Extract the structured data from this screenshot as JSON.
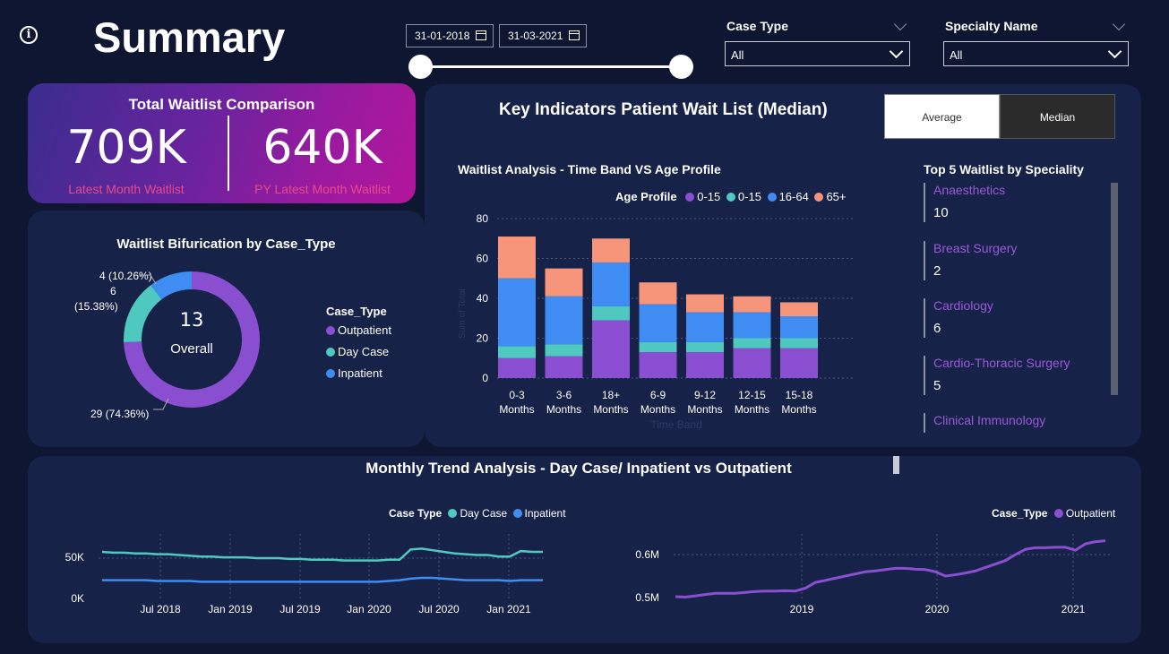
{
  "header": {
    "title": "Summary"
  },
  "date_filter": {
    "start": "31-01-2018",
    "end": "31-03-2021"
  },
  "filters": {
    "case_type": {
      "label": "Case Type",
      "value": "All"
    },
    "specialty": {
      "label": "Specialty Name",
      "value": "All"
    }
  },
  "kpi": {
    "title": "Total Waitlist Comparison",
    "latest_value": "709K",
    "latest_label": "Latest Month Waitlist",
    "py_value": "640K",
    "py_label": "PY Latest Month Waitlist"
  },
  "donut": {
    "title": "Waitlist Bifurication by Case_Type",
    "center_value": "13",
    "center_label": "Overall",
    "legend_title": "Case_Type",
    "slices": [
      {
        "name": "Outpatient",
        "value": 29,
        "label": "29 (74.36%)",
        "color": "#8a4fd1"
      },
      {
        "name": "Day Case",
        "value": 6,
        "label_1": "6",
        "label_2": "(15.38%)",
        "color": "#4fc9c0"
      },
      {
        "name": "Inpatient",
        "value": 4,
        "label": "4 (10.26%)",
        "color": "#3f8cf2"
      }
    ]
  },
  "key_indicators": {
    "title": "Key Indicators Patient Wait List (Median)",
    "toggle_average": "Average",
    "toggle_median": "Median"
  },
  "bar_chart": {
    "title": "Waitlist Analysis - Time Band VS Age Profile",
    "legend_title": "Age Profile",
    "legend": [
      "0-15",
      "0-15",
      "16-64",
      "65+"
    ],
    "colors": [
      "#8a4fd1",
      "#4fc9c0",
      "#3f8cf2",
      "#f7957a"
    ],
    "xlabel": "Time Band",
    "ylabel": "Sum of Total"
  },
  "top5": {
    "title": "Top 5 Waitlist by Speciality",
    "items": [
      {
        "name": "Anaesthetics",
        "value": "10"
      },
      {
        "name": "Breast Surgery",
        "value": "2"
      },
      {
        "name": "Cardiology",
        "value": "6"
      },
      {
        "name": "Cardio-Thoracic Surgery",
        "value": "5"
      },
      {
        "name": "Clinical Immunology",
        "value": ""
      }
    ]
  },
  "trend": {
    "title": "Monthly Trend Analysis - Day Case/ Inpatient vs Outpatient",
    "left_legend_title": "Case Type",
    "left_legend": [
      "Day Case",
      "Inpatient"
    ],
    "right_legend_title": "Case_Type",
    "right_legend": [
      "Outpatient"
    ],
    "left_y_ticks": [
      "50K",
      "0K"
    ],
    "left_x_ticks": [
      "Jul 2018",
      "Jan 2019",
      "Jul 2019",
      "Jan 2020",
      "Jul 2020",
      "Jan 2021"
    ],
    "right_y_ticks": [
      "0.6M",
      "0.5M"
    ],
    "right_x_ticks": [
      "2019",
      "2020",
      "2021"
    ]
  },
  "chart_data": [
    {
      "type": "bar",
      "title": "Waitlist Analysis - Time Band VS Age Profile",
      "categories": [
        "0-3 Months",
        "3-6 Months",
        "18+ Months",
        "6-9 Months",
        "9-12 Months",
        "12-15 Months",
        "15-18 Months"
      ],
      "category_lines": [
        [
          "0-3",
          "Months"
        ],
        [
          "3-6",
          "Months"
        ],
        [
          "18+",
          "Months"
        ],
        [
          "6-9",
          "Months"
        ],
        [
          "9-12",
          "Months"
        ],
        [
          "12-15",
          "Months"
        ],
        [
          "15-18",
          "Months"
        ]
      ],
      "series": [
        {
          "name": "0-15",
          "values": [
            10,
            11,
            29,
            13,
            13,
            15,
            15
          ]
        },
        {
          "name": "0-15",
          "values": [
            6,
            6,
            7,
            5,
            5,
            5,
            5
          ]
        },
        {
          "name": "16-64",
          "values": [
            34,
            24,
            22,
            19,
            15,
            13,
            11
          ]
        },
        {
          "name": "65+",
          "values": [
            21,
            14,
            12,
            11,
            9,
            8,
            7
          ]
        }
      ],
      "stacked": true,
      "ylim": [
        0,
        80
      ],
      "yticks": [
        0,
        20,
        40,
        60,
        80
      ],
      "xlabel": "Time Band",
      "ylabel": "Sum of Total"
    },
    {
      "type": "line",
      "series": [
        {
          "name": "Day Case",
          "values": [
            58,
            57,
            57,
            56,
            56,
            55,
            55,
            54,
            53,
            52,
            52,
            51,
            51,
            51,
            50,
            50,
            50,
            49,
            49,
            48,
            48,
            48,
            47,
            47,
            47,
            47,
            48,
            48,
            61,
            62,
            60,
            58,
            56,
            55,
            54,
            54,
            52,
            52,
            59,
            58,
            58
          ]
        },
        {
          "name": "Inpatient",
          "values": [
            22,
            22,
            22,
            22,
            22,
            21,
            21,
            21,
            21,
            20,
            20,
            20,
            20,
            20,
            20,
            20,
            20,
            20,
            20,
            20,
            20,
            20,
            20,
            20,
            20,
            20,
            21,
            22,
            24,
            25,
            25,
            24,
            23,
            22,
            22,
            22,
            22,
            21,
            22,
            22,
            22
          ]
        }
      ],
      "x_start": "Mar 2018",
      "x_end": "Mar 2021",
      "y_ticks": [
        "0K",
        "50K"
      ]
    },
    {
      "type": "line",
      "series": [
        {
          "name": "Outpatient",
          "values": [
            0.502,
            0.501,
            0.504,
            0.507,
            0.51,
            0.51,
            0.51,
            0.512,
            0.514,
            0.515,
            0.515,
            0.516,
            0.515,
            0.522,
            0.535,
            0.54,
            0.545,
            0.55,
            0.555,
            0.56,
            0.562,
            0.565,
            0.568,
            0.568,
            0.566,
            0.565,
            0.56,
            0.55,
            0.553,
            0.557,
            0.562,
            0.57,
            0.578,
            0.586,
            0.6,
            0.612,
            0.616,
            0.616,
            0.617,
            0.617,
            0.61,
            0.625,
            0.63,
            0.632
          ]
        }
      ],
      "x_start": "Jun 2018",
      "x_end": "Mar 2021",
      "y_ticks": [
        "0.5M",
        "0.6M"
      ]
    }
  ]
}
